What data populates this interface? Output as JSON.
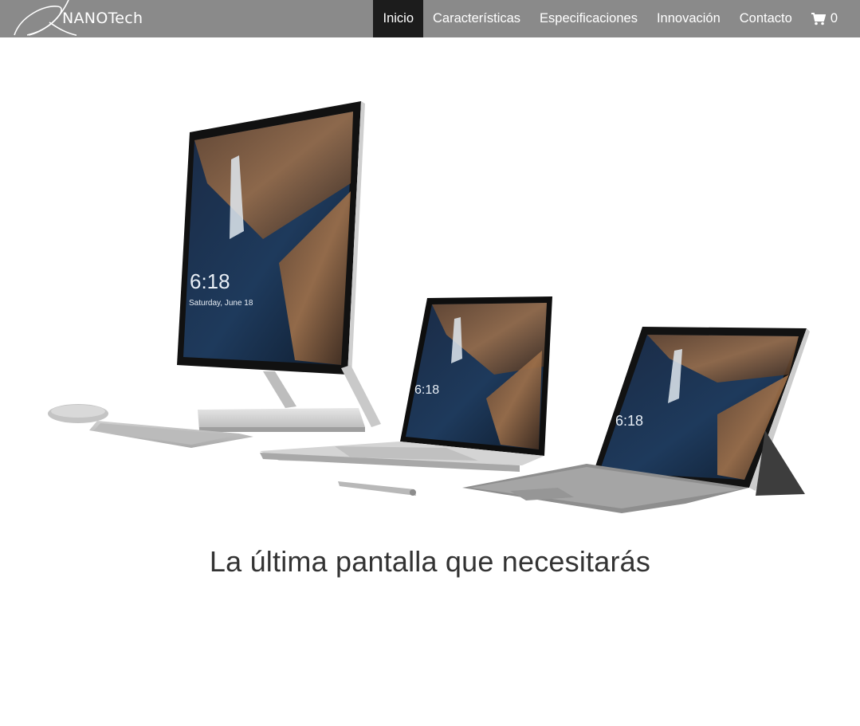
{
  "brand": {
    "name": "NANOTech",
    "logo_icon": "swoosh-logo-icon"
  },
  "nav": {
    "items": [
      {
        "label": "Inicio",
        "active": true
      },
      {
        "label": "Características",
        "active": false
      },
      {
        "label": "Especificaciones",
        "active": false
      },
      {
        "label": "Innovación",
        "active": false
      },
      {
        "label": "Contacto",
        "active": false
      }
    ],
    "cart": {
      "icon": "cart-icon",
      "count": "0"
    }
  },
  "hero": {
    "devices": [
      "desktop-all-in-one",
      "detachable-laptop",
      "tablet-with-keyboard"
    ],
    "lock_screen_time": "6:18",
    "lock_screen_date": "Saturday, June 18"
  },
  "tagline": "La última pantalla que necesitarás",
  "colors": {
    "navbar": "#8a8a8a",
    "active_tab": "#1c1c1c",
    "text": "#333333"
  }
}
